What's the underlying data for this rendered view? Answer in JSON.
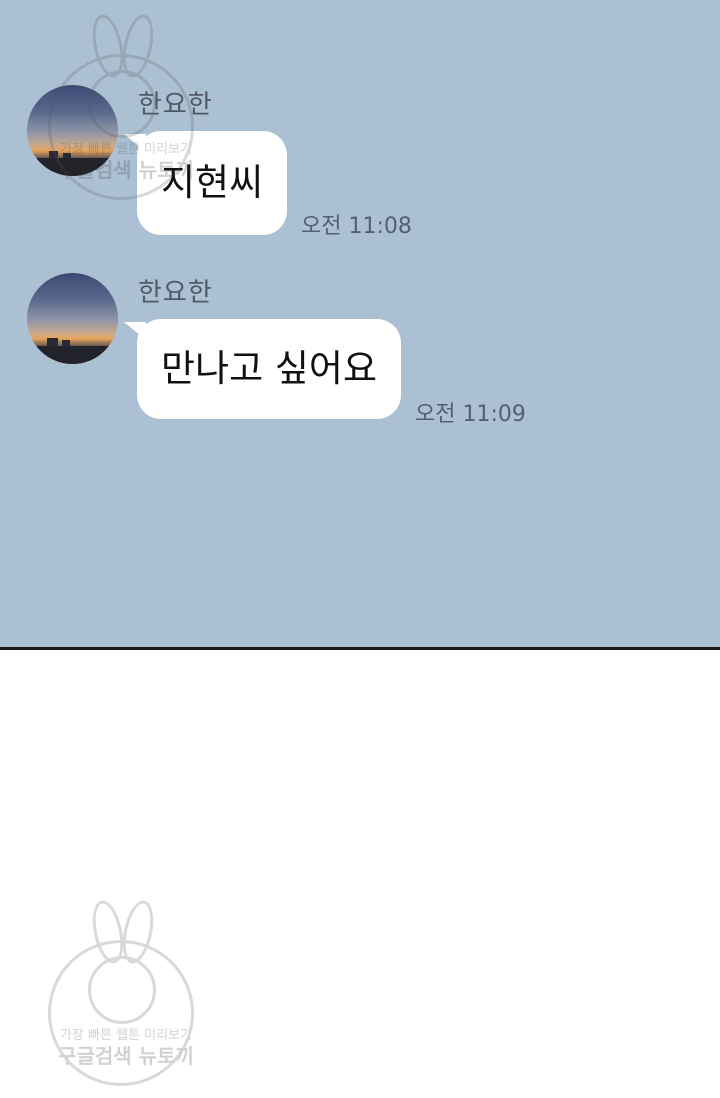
{
  "chat": {
    "messages": [
      {
        "sender": "한요한",
        "text": "지현씨",
        "time": "오전 11:08"
      },
      {
        "sender": "한요한",
        "text": "만나고 싶어요",
        "time": "오전 11:09"
      }
    ],
    "background_color": "#abc1d3",
    "bubble_color": "#ffffff"
  },
  "watermark": {
    "line1": "가장 빠른 웹툰 미리보기",
    "line2": "구글검색 뉴토끼"
  }
}
